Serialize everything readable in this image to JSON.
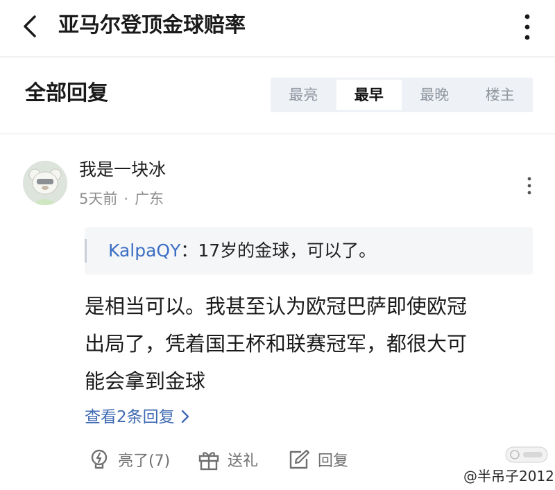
{
  "header": {
    "title": "亚马尔登顶金球赔率",
    "back_icon": "chevron-left-icon",
    "more_icon": "more-vertical-icon"
  },
  "section": {
    "title": "全部回复",
    "sort_tabs": [
      "最亮",
      "最早",
      "最晚",
      "楼主"
    ],
    "active_tab": "最早"
  },
  "comment": {
    "username": "我是一块冰",
    "time": "5天前",
    "separator": "·",
    "location": "广东",
    "quote": {
      "author": "KalpaQY",
      "separator": "：",
      "text": "17岁的金球，可以了。"
    },
    "body_lines": [
      "是相当可以。我甚至认为欧冠巴萨即使欧冠",
      "出局了，凭着国王杯和联赛冠军，都很大可",
      "能会拿到金球"
    ],
    "view_replies": "查看2条回复",
    "actions": {
      "like_label": "亮了(7)",
      "gift_label": "送礼",
      "reply_label": "回复"
    }
  },
  "watermark": {
    "text": "@半吊子2012"
  },
  "colors": {
    "link": "#3e6ab3",
    "quote_author": "#3b6fc4",
    "tab_bg": "#eef1f5",
    "muted": "#8e8e8e"
  }
}
